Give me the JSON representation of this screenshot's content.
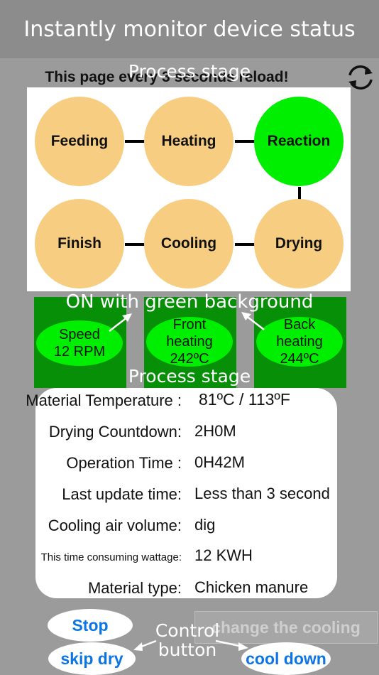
{
  "header": {
    "title": "Instantly monitor device status"
  },
  "reload_note": "This page every 3 seconds reload!",
  "icons": {
    "refresh": "refresh-icon"
  },
  "annotations": {
    "process_stage_top": "Process stage",
    "process_stage_mid": "Process stage",
    "on_hint": "ON with green background",
    "control_button": "Control button"
  },
  "stages": [
    {
      "label": "Feeding",
      "active": false
    },
    {
      "label": "Heating",
      "active": false
    },
    {
      "label": "Reaction",
      "active": true
    },
    {
      "label": "Finish",
      "active": false
    },
    {
      "label": "Cooling",
      "active": false
    },
    {
      "label": "Drying",
      "active": false
    }
  ],
  "heaters": [
    {
      "line1": "Speed",
      "line2": "12 RPM"
    },
    {
      "line1": "Front heating",
      "line2": "242ºC"
    },
    {
      "line1": "Back heating",
      "line2": "244ºC"
    }
  ],
  "info": [
    {
      "label": "Material Temperature :",
      "value": "81ºC / 113ºF"
    },
    {
      "label": "Drying Countdown:",
      "value": "2H0M"
    },
    {
      "label": "Operation Time :",
      "value": "0H42M"
    },
    {
      "label": "Last update time:",
      "value": "Less than 3 second"
    },
    {
      "label": "Cooling air volume:",
      "value": "dig"
    },
    {
      "label": "This time consuming wattage:",
      "value": "12 KWH"
    },
    {
      "label": "Material type:",
      "value": "Chicken manure"
    }
  ],
  "controls": {
    "stop": "Stop",
    "skip_dry": "skip dry",
    "change_cooling": "change the cooling",
    "cool_down": "cool down"
  },
  "colors": {
    "active_stage": "#00ee00",
    "inactive_stage": "#f7cd82",
    "heater_bg": "#078f07",
    "button_text": "#0d74e6"
  }
}
